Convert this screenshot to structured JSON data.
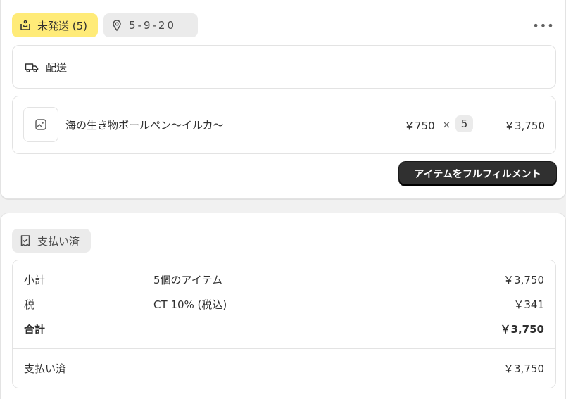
{
  "fulfillment": {
    "status_label": "未発送 (5)",
    "location_label": "5-9-20",
    "delivery_label": "配送",
    "item": {
      "title": "海の生き物ボールペン〜イルカ〜",
      "unit_price": "￥750",
      "times": "×",
      "quantity": "5",
      "total": "￥3,750"
    },
    "fulfill_button_label": "アイテムをフルフィルメント",
    "more_label": "•••"
  },
  "payment": {
    "status_label": "支払い済",
    "rows": [
      {
        "label": "小計",
        "description": "5個のアイテム",
        "amount": "￥3,750"
      },
      {
        "label": "税",
        "description": "CT 10% (税込)",
        "amount": "￥341"
      },
      {
        "label": "合計",
        "description": "",
        "amount": "￥3,750"
      }
    ],
    "paid_row": {
      "label": "支払い済",
      "amount": "￥3,750"
    }
  },
  "colors": {
    "unfulfilled_badge": "#ffeb78",
    "neutral_badge": "#ebebeb",
    "primary_button": "#303030"
  },
  "icons": [
    "unfulfilled-icon",
    "location-pin-icon",
    "delivery-truck-icon",
    "image-placeholder-icon",
    "payment-receipt-icon",
    "more-horizontal-icon"
  ]
}
